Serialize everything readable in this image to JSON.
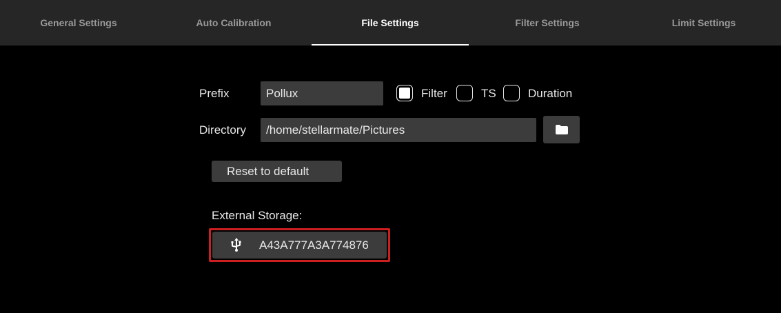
{
  "tabs": [
    {
      "label": "General Settings"
    },
    {
      "label": "Auto Calibration"
    },
    {
      "label": "File Settings"
    },
    {
      "label": "Filter Settings"
    },
    {
      "label": "Limit Settings"
    }
  ],
  "active_tab": "File Settings",
  "form": {
    "prefix_label": "Prefix",
    "prefix_value": "Pollux",
    "filter_label": "Filter",
    "filter_checked": true,
    "ts_label": "TS",
    "ts_checked": false,
    "duration_label": "Duration",
    "duration_checked": false,
    "directory_label": "Directory",
    "directory_value": "/home/stellarmate/Pictures",
    "folder_icon": "folder-icon",
    "reset_label": "Reset to default"
  },
  "external_storage": {
    "label": "External Storage:",
    "device_icon": "usb-icon",
    "device_name": "A43A777A3A774876",
    "highlight_color": "#cc1f1f"
  },
  "colors": {
    "background": "#000000",
    "tabbar": "#262626",
    "field": "#3c3c3c"
  }
}
